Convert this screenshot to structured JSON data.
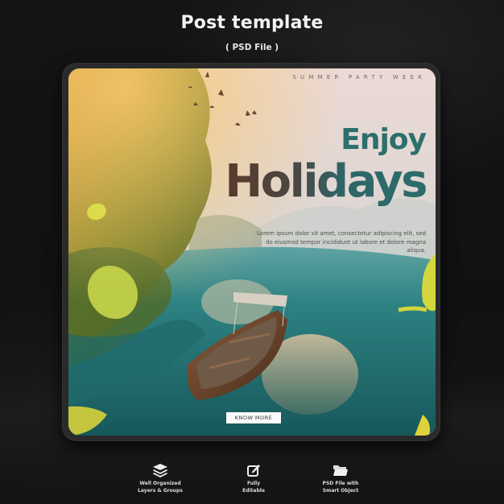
{
  "header": {
    "title": "Post template",
    "subtitle": "( PSD File )"
  },
  "poster": {
    "tagline": "SUMMER PARTY WEEK",
    "headline_line1": "Enjoy",
    "headline_line2": "Holidays",
    "body": "Lorem ipsum dolor sit amet, consectetur adipiscing elit, sed do eiusmod tempor incididunt ut labore et dolore magna aliqua.",
    "cta_label": "KNOW MORE",
    "scene": "boat-on-turquoise-lake-with-trees-and-birds",
    "colors": {
      "accent_teal": "#2c6f6c",
      "headline_brown": "#5a3a2a",
      "leaf_yellow": "#d6dc3a"
    }
  },
  "features": [
    {
      "icon": "layers-icon",
      "label": "Well Organized\nLayers & Groups"
    },
    {
      "icon": "edit-icon",
      "label": "Fully\nEditable"
    },
    {
      "icon": "folder-icon",
      "label": "PSD File with\nSmart Object"
    }
  ]
}
